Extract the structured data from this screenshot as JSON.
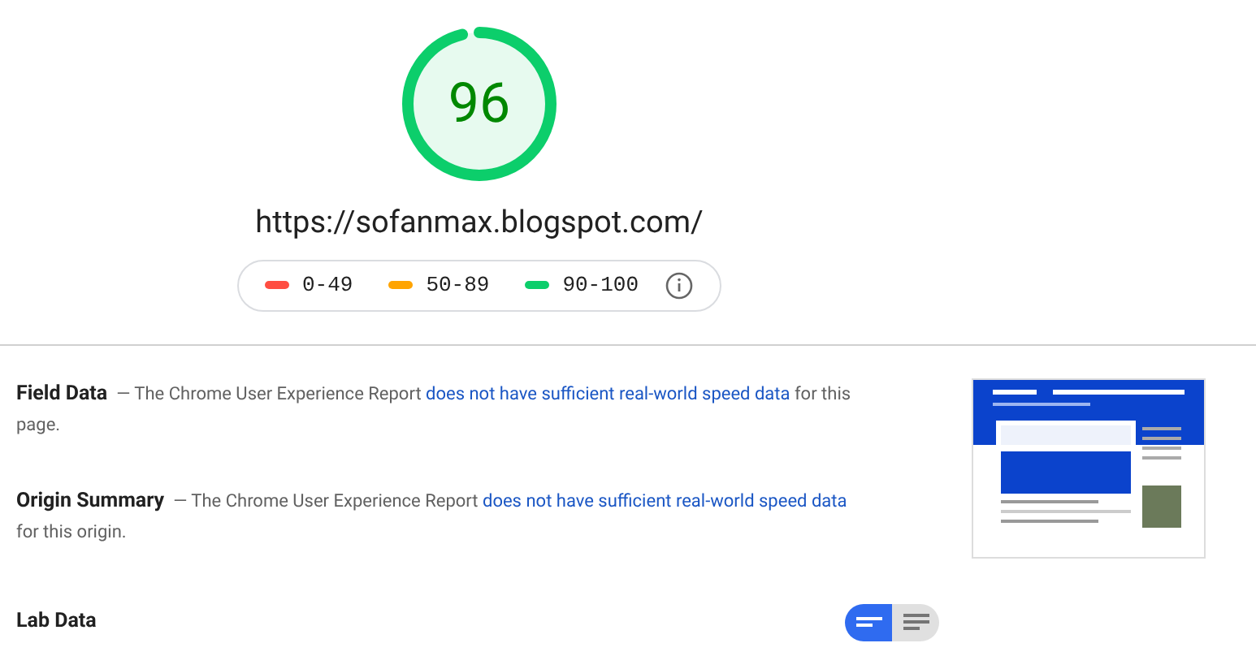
{
  "score": {
    "value": "96",
    "level": 0.96
  },
  "url": "https://sofanmax.blogspot.com/",
  "legend": [
    {
      "label": "0-49",
      "color": "#ff4e42"
    },
    {
      "label": "50-89",
      "color": "#ffa400"
    },
    {
      "label": "90-100",
      "color": "#0cce6b"
    }
  ],
  "sections": [
    {
      "title": "Field Data",
      "text": "— The Chrome User Experience Report ",
      "link": "does not have sufficient real-world speed data",
      "after": " for this page."
    },
    {
      "title": "Origin Summary",
      "text": "— The Chrome User Experience Report ",
      "link": "does not have sufficient real-world speed data",
      "after": " for this origin."
    }
  ],
  "lab": {
    "title": "Lab Data"
  },
  "view_toggle": [
    {
      "kind": "summary",
      "selected": true
    },
    {
      "kind": "list",
      "selected": false
    }
  ]
}
